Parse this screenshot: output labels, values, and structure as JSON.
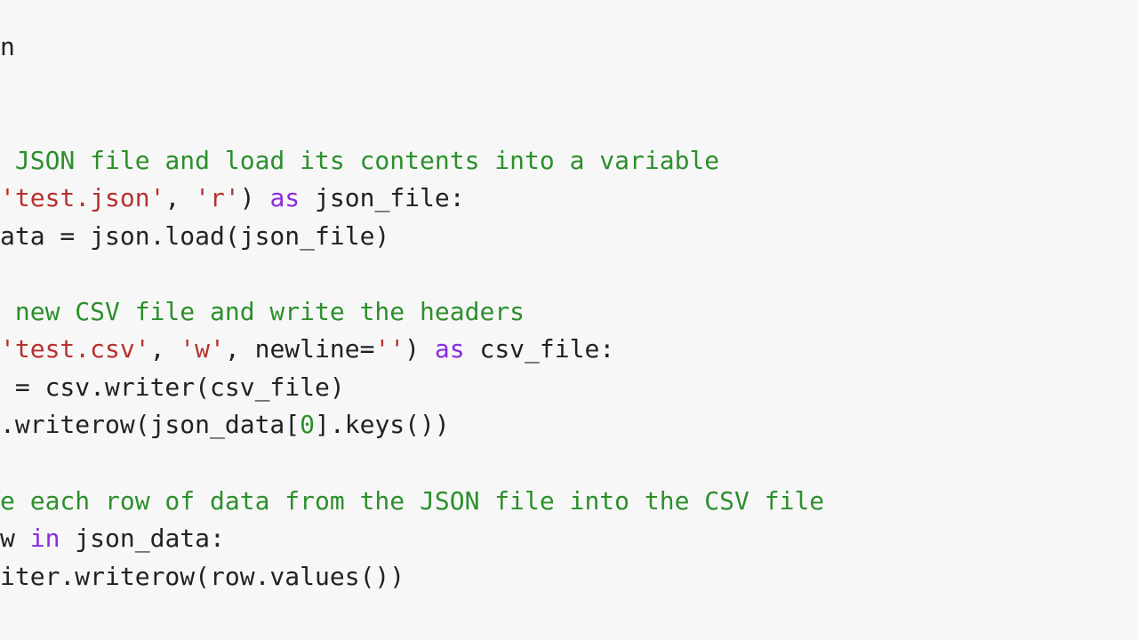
{
  "code": {
    "lines": [
      {
        "tokens": [
          {
            "cls": "tok-default",
            "text": "n"
          }
        ]
      },
      {
        "tokens": [
          {
            "cls": "tok-default",
            "text": ""
          }
        ]
      },
      {
        "tokens": [
          {
            "cls": "tok-default",
            "text": ""
          }
        ]
      },
      {
        "tokens": [
          {
            "cls": "tok-comment",
            "text": " JSON file and load its contents into a variable"
          }
        ]
      },
      {
        "tokens": [
          {
            "cls": "tok-string",
            "text": "'test.json'"
          },
          {
            "cls": "tok-default",
            "text": ", "
          },
          {
            "cls": "tok-string",
            "text": "'r'"
          },
          {
            "cls": "tok-default",
            "text": ") "
          },
          {
            "cls": "tok-keyword",
            "text": "as"
          },
          {
            "cls": "tok-default",
            "text": " json_file:"
          }
        ]
      },
      {
        "tokens": [
          {
            "cls": "tok-default",
            "text": "ata = json.load(json_file)"
          }
        ]
      },
      {
        "tokens": [
          {
            "cls": "tok-default",
            "text": ""
          }
        ]
      },
      {
        "tokens": [
          {
            "cls": "tok-comment",
            "text": " new CSV file and write the headers"
          }
        ]
      },
      {
        "tokens": [
          {
            "cls": "tok-string",
            "text": "'test.csv'"
          },
          {
            "cls": "tok-default",
            "text": ", "
          },
          {
            "cls": "tok-string",
            "text": "'w'"
          },
          {
            "cls": "tok-default",
            "text": ", newline="
          },
          {
            "cls": "tok-string",
            "text": "''"
          },
          {
            "cls": "tok-default",
            "text": ") "
          },
          {
            "cls": "tok-keyword",
            "text": "as"
          },
          {
            "cls": "tok-default",
            "text": " csv_file:"
          }
        ]
      },
      {
        "tokens": [
          {
            "cls": "tok-default",
            "text": " = csv.writer(csv_file)"
          }
        ]
      },
      {
        "tokens": [
          {
            "cls": "tok-default",
            "text": ".writerow(json_data["
          },
          {
            "cls": "tok-number",
            "text": "0"
          },
          {
            "cls": "tok-default",
            "text": "].keys())"
          }
        ]
      },
      {
        "tokens": [
          {
            "cls": "tok-default",
            "text": ""
          }
        ]
      },
      {
        "tokens": [
          {
            "cls": "tok-comment",
            "text": "e each row of data from the JSON file into the CSV file"
          }
        ]
      },
      {
        "tokens": [
          {
            "cls": "tok-default",
            "text": "w "
          },
          {
            "cls": "tok-keyword",
            "text": "in"
          },
          {
            "cls": "tok-default",
            "text": " json_data:"
          }
        ]
      },
      {
        "tokens": [
          {
            "cls": "tok-default",
            "text": "iter.writerow(row.values())"
          }
        ]
      }
    ]
  }
}
